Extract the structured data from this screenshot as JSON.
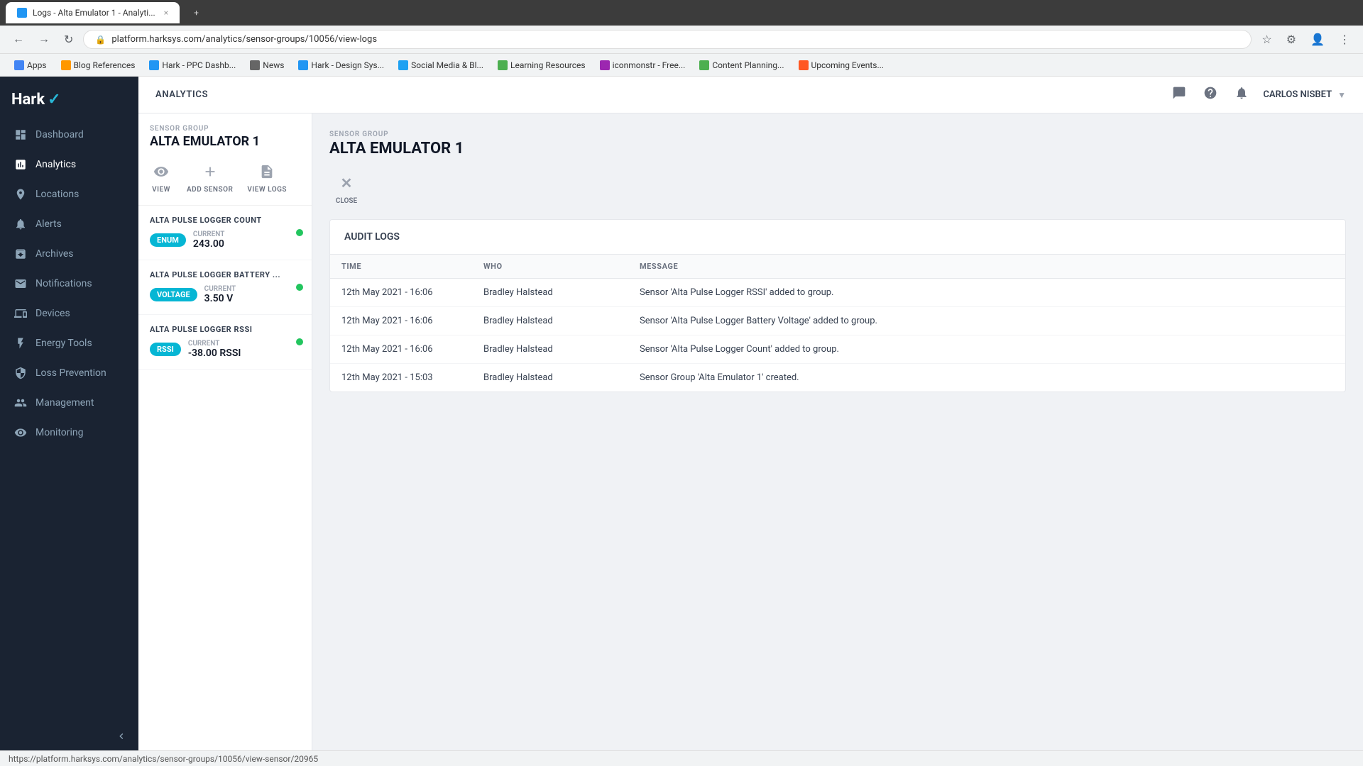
{
  "browser": {
    "tab_active": "Logs - Alta Emulator 1 - Analyti...",
    "tab_new_label": "+",
    "address": "platform.harksys.com/analytics/sensor-groups/10056/view-logs",
    "bookmarks": [
      {
        "label": "Apps",
        "type": "apps"
      },
      {
        "label": "Blog References",
        "type": "blog"
      },
      {
        "label": "Hark - PPC Dashb...",
        "type": "hark-ppc"
      },
      {
        "label": "News",
        "type": "news"
      },
      {
        "label": "Hark - Design Sys...",
        "type": "hark-design"
      },
      {
        "label": "Social Media & Bl...",
        "type": "social"
      },
      {
        "label": "Learning Resources",
        "type": "learning"
      },
      {
        "label": "iconmonstr - Free...",
        "type": "iconmonstr"
      },
      {
        "label": "Content Planning...",
        "type": "content"
      },
      {
        "label": "Upcoming Events...",
        "type": "upcoming"
      }
    ]
  },
  "header": {
    "breadcrumb": "ANALYTICS",
    "user": "CARLOS NISBET"
  },
  "sidebar": {
    "logo": "Hark",
    "items": [
      {
        "label": "Dashboard",
        "icon": "dashboard"
      },
      {
        "label": "Analytics",
        "icon": "analytics",
        "active": true
      },
      {
        "label": "Locations",
        "icon": "locations"
      },
      {
        "label": "Alerts",
        "icon": "alerts"
      },
      {
        "label": "Archives",
        "icon": "archives"
      },
      {
        "label": "Notifications",
        "icon": "notifications"
      },
      {
        "label": "Devices",
        "icon": "devices"
      },
      {
        "label": "Energy Tools",
        "icon": "energy"
      },
      {
        "label": "Loss Prevention",
        "icon": "loss"
      },
      {
        "label": "Management",
        "icon": "management"
      },
      {
        "label": "Monitoring",
        "icon": "monitoring"
      }
    ]
  },
  "left_panel": {
    "sensor_group_label": "SENSOR GROUP",
    "sensor_group_name": "ALTA EMULATOR 1",
    "actions": [
      {
        "label": "VIEW",
        "icon": "view"
      },
      {
        "label": "ADD SENSOR",
        "icon": "add"
      },
      {
        "label": "VIEW LOGS",
        "icon": "logs"
      }
    ],
    "sensors": [
      {
        "name": "ALTA PULSE LOGGER COUNT",
        "badge": "ENUM",
        "badge_type": "enum",
        "current_label": "CURRENT",
        "current_value": "243.00",
        "status": "active"
      },
      {
        "name": "ALTA PULSE LOGGER BATTERY ...",
        "badge": "VOLTAGE",
        "badge_type": "voltage",
        "current_label": "CURRENT",
        "current_value": "3.50 V",
        "status": "active"
      },
      {
        "name": "ALTA PULSE LOGGER RSSI",
        "badge": "RSSI",
        "badge_type": "rssi",
        "current_label": "CURRENT",
        "current_value": "-38.00 RSSI",
        "status": "active"
      }
    ]
  },
  "right_panel": {
    "sensor_group_label": "SENSOR GROUP",
    "sensor_group_name": "ALTA EMULATOR 1",
    "close_label": "CLOSE",
    "audit_logs": {
      "title": "AUDIT LOGS",
      "columns": [
        "TIME",
        "WHO",
        "MESSAGE"
      ],
      "rows": [
        {
          "time": "12th May 2021 - 16:06",
          "who": "Bradley Halstead",
          "message": "Sensor 'Alta Pulse Logger RSSI' added to group."
        },
        {
          "time": "12th May 2021 - 16:06",
          "who": "Bradley Halstead",
          "message": "Sensor 'Alta Pulse Logger Battery Voltage' added to group."
        },
        {
          "time": "12th May 2021 - 16:06",
          "who": "Bradley Halstead",
          "message": "Sensor 'Alta Pulse Logger Count' added to group."
        },
        {
          "time": "12th May 2021 - 15:03",
          "who": "Bradley Halstead",
          "message": "Sensor Group 'Alta Emulator 1' created."
        }
      ]
    }
  },
  "status_bar": {
    "url": "https://platform.harksys.com/analytics/sensor-groups/10056/view-sensor/20965"
  }
}
